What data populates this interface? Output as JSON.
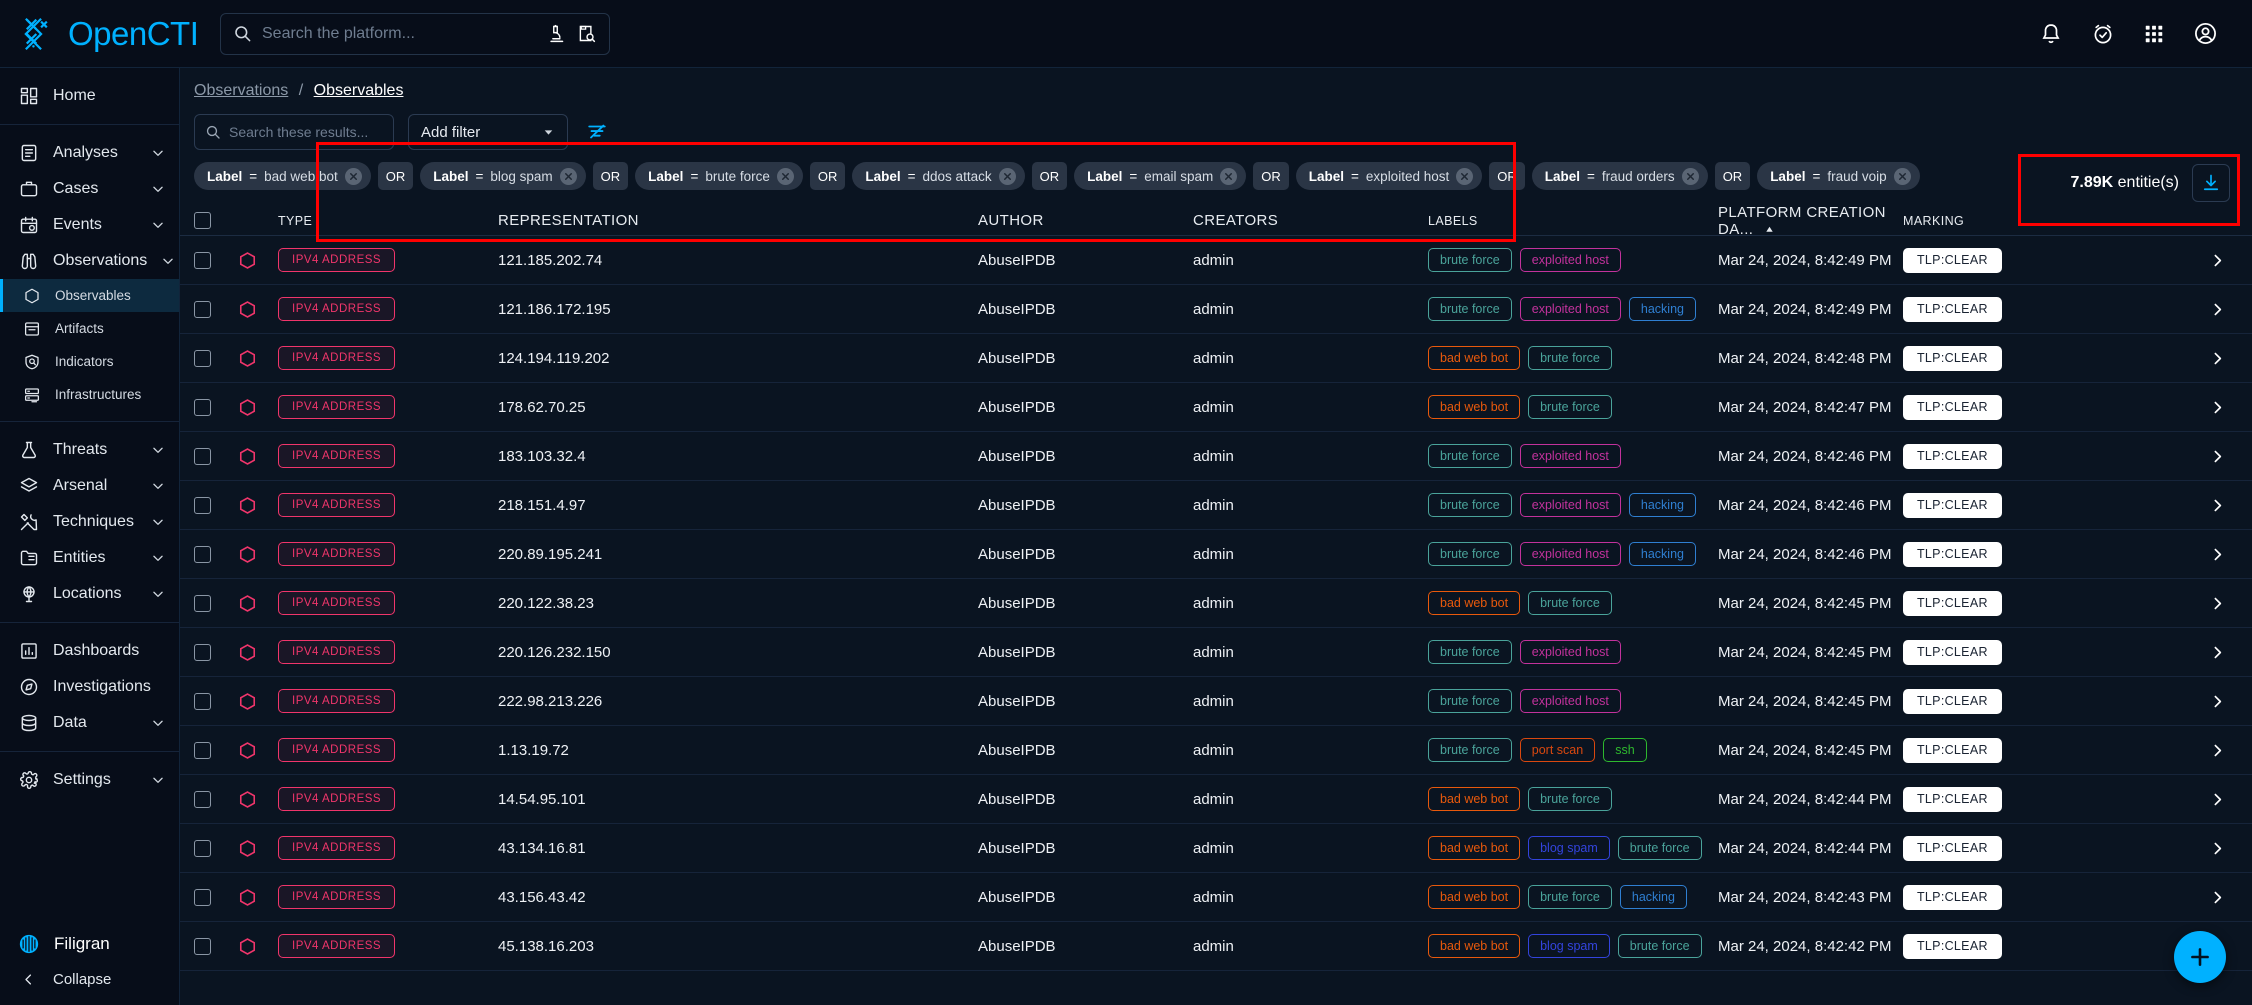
{
  "app": {
    "brand": "OpenCTI",
    "accent": "#00b1ff",
    "platform_search_placeholder": "Search the platform..."
  },
  "sidebar": {
    "groups": [
      {
        "items": [
          {
            "label": "Home",
            "icon": "dashboard-grid-icon",
            "active": false,
            "sub": false,
            "chevron": false
          }
        ]
      },
      {
        "items": [
          {
            "label": "Analyses",
            "icon": "clipboard-text-icon",
            "active": false,
            "sub": false,
            "chevron": true
          },
          {
            "label": "Cases",
            "icon": "briefcase-icon",
            "active": false,
            "sub": false,
            "chevron": true
          },
          {
            "label": "Events",
            "icon": "calendar-clock-icon",
            "active": false,
            "sub": false,
            "chevron": true
          },
          {
            "label": "Observations",
            "icon": "binoculars-icon",
            "active": false,
            "sub": false,
            "chevron": true
          },
          {
            "label": "Observables",
            "icon": "hexagon-icon",
            "active": true,
            "sub": true,
            "chevron": false
          },
          {
            "label": "Artifacts",
            "icon": "archive-box-icon",
            "active": false,
            "sub": true,
            "chevron": false
          },
          {
            "label": "Indicators",
            "icon": "shield-search-icon",
            "active": false,
            "sub": true,
            "chevron": false
          },
          {
            "label": "Infrastructures",
            "icon": "server-icon",
            "active": false,
            "sub": true,
            "chevron": false
          }
        ]
      },
      {
        "items": [
          {
            "label": "Threats",
            "icon": "flask-icon",
            "active": false,
            "sub": false,
            "chevron": true
          },
          {
            "label": "Arsenal",
            "icon": "layers-icon",
            "active": false,
            "sub": false,
            "chevron": true
          },
          {
            "label": "Techniques",
            "icon": "tools-icon",
            "active": false,
            "sub": false,
            "chevron": true
          },
          {
            "label": "Entities",
            "icon": "folder-grid-icon",
            "active": false,
            "sub": false,
            "chevron": true
          },
          {
            "label": "Locations",
            "icon": "globe-stand-icon",
            "active": false,
            "sub": false,
            "chevron": true
          }
        ]
      },
      {
        "items": [
          {
            "label": "Dashboards",
            "icon": "bar-chart-icon",
            "active": false,
            "sub": false,
            "chevron": false
          },
          {
            "label": "Investigations",
            "icon": "compass-icon",
            "active": false,
            "sub": false,
            "chevron": false
          },
          {
            "label": "Data",
            "icon": "database-icon",
            "active": false,
            "sub": false,
            "chevron": true
          }
        ]
      },
      {
        "items": [
          {
            "label": "Settings",
            "icon": "gear-icon",
            "active": false,
            "sub": false,
            "chevron": true
          }
        ]
      }
    ],
    "footer": {
      "brand": "Filigran",
      "collapse": "Collapse"
    }
  },
  "breadcrumb": {
    "parent": "Observations",
    "separator": "/",
    "current": "Observables"
  },
  "filters": {
    "search_placeholder": "Search these results...",
    "add_filter_label": "Add filter",
    "operator": "OR",
    "chips": [
      {
        "key": "Label",
        "eq": "=",
        "value": "bad web bot"
      },
      {
        "key": "Label",
        "eq": "=",
        "value": "blog spam"
      },
      {
        "key": "Label",
        "eq": "=",
        "value": "brute force"
      },
      {
        "key": "Label",
        "eq": "=",
        "value": "ddos attack"
      },
      {
        "key": "Label",
        "eq": "=",
        "value": "email spam"
      },
      {
        "key": "Label",
        "eq": "=",
        "value": "exploited host"
      },
      {
        "key": "Label",
        "eq": "=",
        "value": "fraud orders"
      },
      {
        "key": "Label",
        "eq": "=",
        "value": "fraud voip"
      }
    ]
  },
  "results": {
    "count_value": "7.89K",
    "count_suffix": "entitie(s)"
  },
  "table": {
    "columns": {
      "type": "Type",
      "representation": "Representation",
      "author": "Author",
      "creators": "Creators",
      "labels": "Labels",
      "date": "Platform creation da...",
      "marking": "Marking"
    },
    "sort": {
      "column": "date",
      "direction": "asc"
    },
    "label_colors": {
      "bad web bot": "#e8590c",
      "blog spam": "#3344dd",
      "brute force": "#4aa39a",
      "exploited host": "#c2329c",
      "hacking": "#2f7fd1",
      "port scan": "#d9480f",
      "ssh": "#2eb82e"
    },
    "rows": [
      {
        "type": "IPV4 ADDRESS",
        "representation": "121.185.202.74",
        "author": "AbuseIPDB",
        "creators": "admin",
        "labels": [
          "brute force",
          "exploited host"
        ],
        "date": "Mar 24, 2024, 8:42:49 PM",
        "marking": "TLP:CLEAR"
      },
      {
        "type": "IPV4 ADDRESS",
        "representation": "121.186.172.195",
        "author": "AbuseIPDB",
        "creators": "admin",
        "labels": [
          "brute force",
          "exploited host",
          "hacking"
        ],
        "date": "Mar 24, 2024, 8:42:49 PM",
        "marking": "TLP:CLEAR"
      },
      {
        "type": "IPV4 ADDRESS",
        "representation": "124.194.119.202",
        "author": "AbuseIPDB",
        "creators": "admin",
        "labels": [
          "bad web bot",
          "brute force"
        ],
        "date": "Mar 24, 2024, 8:42:48 PM",
        "marking": "TLP:CLEAR"
      },
      {
        "type": "IPV4 ADDRESS",
        "representation": "178.62.70.25",
        "author": "AbuseIPDB",
        "creators": "admin",
        "labels": [
          "bad web bot",
          "brute force"
        ],
        "date": "Mar 24, 2024, 8:42:47 PM",
        "marking": "TLP:CLEAR"
      },
      {
        "type": "IPV4 ADDRESS",
        "representation": "183.103.32.4",
        "author": "AbuseIPDB",
        "creators": "admin",
        "labels": [
          "brute force",
          "exploited host"
        ],
        "date": "Mar 24, 2024, 8:42:46 PM",
        "marking": "TLP:CLEAR"
      },
      {
        "type": "IPV4 ADDRESS",
        "representation": "218.151.4.97",
        "author": "AbuseIPDB",
        "creators": "admin",
        "labels": [
          "brute force",
          "exploited host",
          "hacking"
        ],
        "date": "Mar 24, 2024, 8:42:46 PM",
        "marking": "TLP:CLEAR"
      },
      {
        "type": "IPV4 ADDRESS",
        "representation": "220.89.195.241",
        "author": "AbuseIPDB",
        "creators": "admin",
        "labels": [
          "brute force",
          "exploited host",
          "hacking"
        ],
        "date": "Mar 24, 2024, 8:42:46 PM",
        "marking": "TLP:CLEAR"
      },
      {
        "type": "IPV4 ADDRESS",
        "representation": "220.122.38.23",
        "author": "AbuseIPDB",
        "creators": "admin",
        "labels": [
          "bad web bot",
          "brute force"
        ],
        "date": "Mar 24, 2024, 8:42:45 PM",
        "marking": "TLP:CLEAR"
      },
      {
        "type": "IPV4 ADDRESS",
        "representation": "220.126.232.150",
        "author": "AbuseIPDB",
        "creators": "admin",
        "labels": [
          "brute force",
          "exploited host"
        ],
        "date": "Mar 24, 2024, 8:42:45 PM",
        "marking": "TLP:CLEAR"
      },
      {
        "type": "IPV4 ADDRESS",
        "representation": "222.98.213.226",
        "author": "AbuseIPDB",
        "creators": "admin",
        "labels": [
          "brute force",
          "exploited host"
        ],
        "date": "Mar 24, 2024, 8:42:45 PM",
        "marking": "TLP:CLEAR"
      },
      {
        "type": "IPV4 ADDRESS",
        "representation": "1.13.19.72",
        "author": "AbuseIPDB",
        "creators": "admin",
        "labels": [
          "brute force",
          "port scan",
          "ssh"
        ],
        "date": "Mar 24, 2024, 8:42:45 PM",
        "marking": "TLP:CLEAR"
      },
      {
        "type": "IPV4 ADDRESS",
        "representation": "14.54.95.101",
        "author": "AbuseIPDB",
        "creators": "admin",
        "labels": [
          "bad web bot",
          "brute force"
        ],
        "date": "Mar 24, 2024, 8:42:44 PM",
        "marking": "TLP:CLEAR"
      },
      {
        "type": "IPV4 ADDRESS",
        "representation": "43.134.16.81",
        "author": "AbuseIPDB",
        "creators": "admin",
        "labels": [
          "bad web bot",
          "blog spam",
          "brute force"
        ],
        "date": "Mar 24, 2024, 8:42:44 PM",
        "marking": "TLP:CLEAR"
      },
      {
        "type": "IPV4 ADDRESS",
        "representation": "43.156.43.42",
        "author": "AbuseIPDB",
        "creators": "admin",
        "labels": [
          "bad web bot",
          "brute force",
          "hacking"
        ],
        "date": "Mar 24, 2024, 8:42:43 PM",
        "marking": "TLP:CLEAR"
      },
      {
        "type": "IPV4 ADDRESS",
        "representation": "45.138.16.203",
        "author": "AbuseIPDB",
        "creators": "admin",
        "labels": [
          "bad web bot",
          "blog spam",
          "brute force"
        ],
        "date": "Mar 24, 2024, 8:42:42 PM",
        "marking": "TLP:CLEAR"
      }
    ]
  }
}
